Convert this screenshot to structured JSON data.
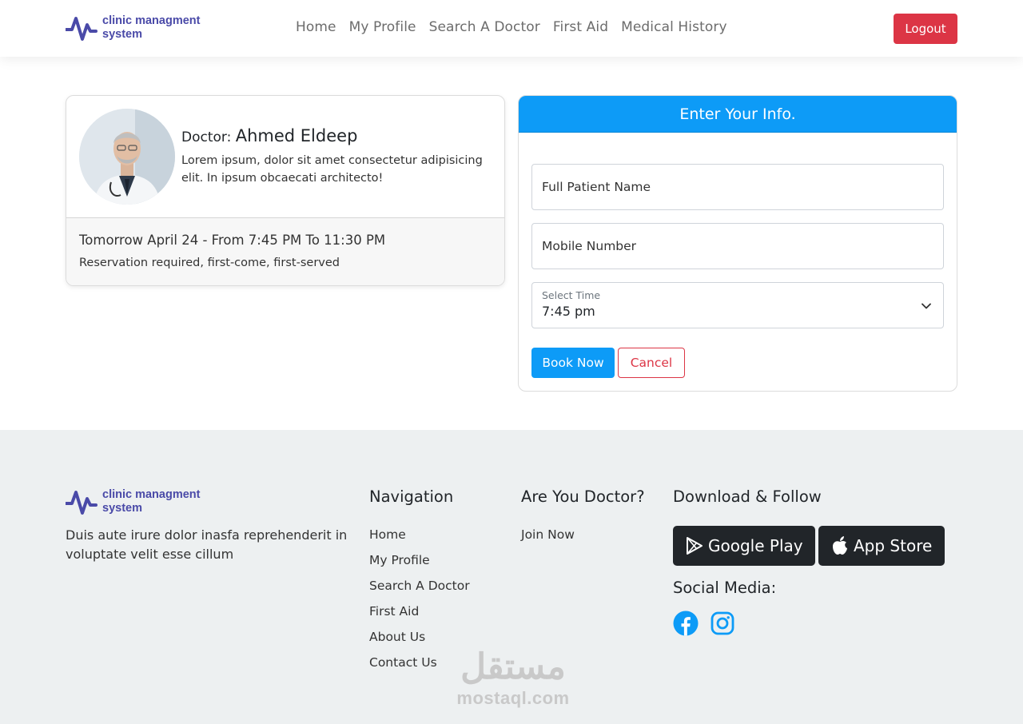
{
  "brand": {
    "name_line1": "clinic managment",
    "name_line2": "system",
    "color": "#4a4aa8"
  },
  "nav": {
    "links": [
      "Home",
      "My Profile",
      "Search A Doctor",
      "First Aid",
      "Medical History"
    ],
    "logout_label": "Logout"
  },
  "doctor": {
    "prefix": "Doctor:",
    "name": "Ahmed Eldeep",
    "description": "Lorem ipsum, dolor sit amet consectetur adipisicing elit. In ipsum obcaecati architecto!",
    "schedule": "Tomorrow April 24 - From 7:45 PM To 11:30 PM",
    "note": "Reservation required, first-come, first-served"
  },
  "form": {
    "title": "Enter Your Info.",
    "name_placeholder": "Full Patient Name",
    "mobile_placeholder": "Mobile Number",
    "time_label": "Select Time",
    "time_value": "7:45 pm",
    "book_label": "Book Now",
    "cancel_label": "Cancel"
  },
  "footer": {
    "description": "Duis aute irure dolor inasfa reprehenderit in voluptate velit esse cillum",
    "navigation_title": "Navigation",
    "navigation_links": [
      "Home",
      "My Profile",
      "Search A Doctor",
      "First Aid",
      "About Us",
      "Contact Us"
    ],
    "doctor_title": "Are You Doctor?",
    "doctor_link": "Join Now",
    "download_title": "Download & Follow",
    "google_play_label": "Google Play",
    "app_store_label": "App Store",
    "social_title": "Social Media:",
    "social_icons": [
      "facebook-icon",
      "instagram-icon"
    ]
  },
  "watermark": {
    "arabic": "مستقل",
    "latin": "mostaql.com"
  },
  "colors": {
    "primary": "#0d9bf7",
    "danger": "#dc3545",
    "footer_bg": "#edf0f1",
    "dark": "#212529"
  }
}
